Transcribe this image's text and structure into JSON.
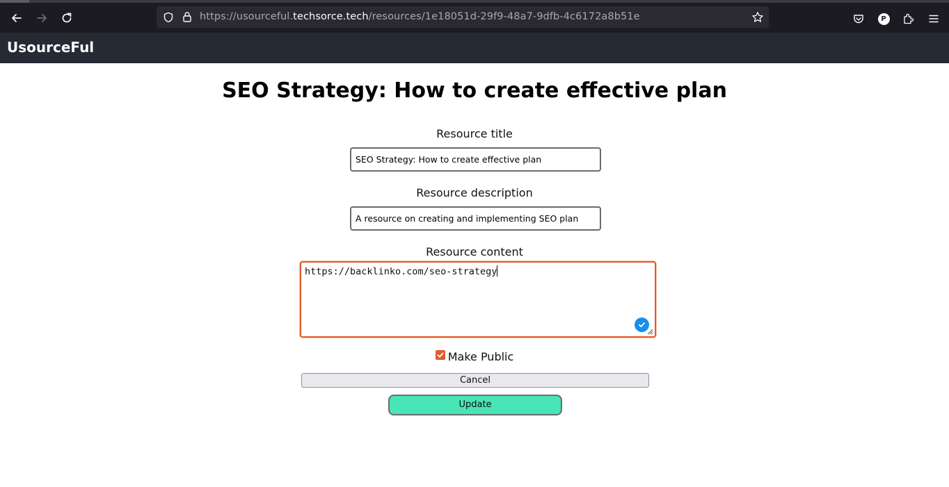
{
  "browser": {
    "url_prefix": "https://usourceful.",
    "url_domain": "techsorce.tech",
    "url_path": "/resources/1e18051d-29f9-48a7-9dfb-4c6172a8b51e",
    "profile_initial": "P"
  },
  "app": {
    "brand": "UsourceFul"
  },
  "form": {
    "page_title": "SEO Strategy: How to create effective plan",
    "title_label": "Resource title",
    "title_value": "SEO Strategy: How to create effective plan",
    "description_label": "Resource description",
    "description_value": "A resource on creating and implementing SEO plan",
    "content_label": "Resource content",
    "content_value": "https://backlinko.com/seo-strategy",
    "public_label": "Make Public",
    "public_checked": true,
    "cancel_label": "Cancel",
    "update_label": "Update"
  },
  "colors": {
    "browser_bg": "#1c1b22",
    "app_header_bg": "#252a33",
    "accent_orange": "#e25c2c",
    "update_button_bg": "#48e5b6",
    "grammar_badge": "#1a8fe8"
  },
  "icons": [
    "back-arrow-icon",
    "forward-arrow-icon",
    "reload-icon",
    "shield-icon",
    "lock-icon",
    "star-icon",
    "pocket-icon",
    "extensions-icon",
    "menu-icon",
    "checkmark-icon",
    "resize-grip-icon"
  ]
}
